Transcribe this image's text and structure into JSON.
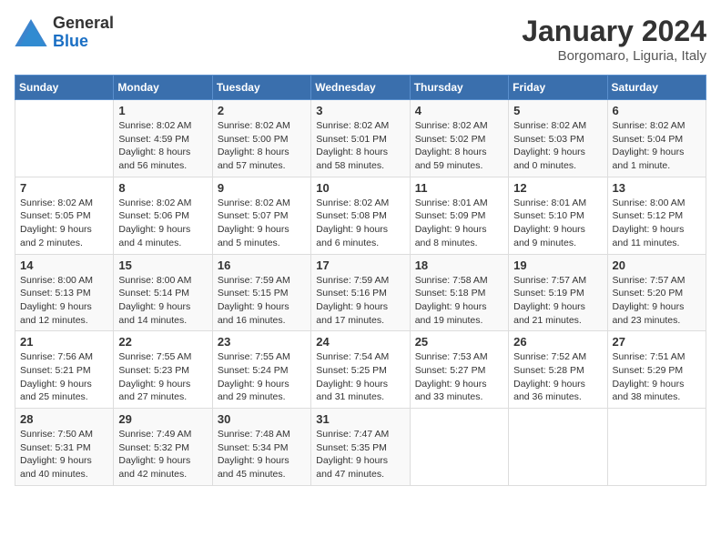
{
  "logo": {
    "general": "General",
    "blue": "Blue"
  },
  "header": {
    "title": "January 2024",
    "subtitle": "Borgomaro, Liguria, Italy"
  },
  "days_of_week": [
    "Sunday",
    "Monday",
    "Tuesday",
    "Wednesday",
    "Thursday",
    "Friday",
    "Saturday"
  ],
  "weeks": [
    [
      {
        "day": "",
        "sunrise": "",
        "sunset": "",
        "daylight": ""
      },
      {
        "day": "1",
        "sunrise": "Sunrise: 8:02 AM",
        "sunset": "Sunset: 4:59 PM",
        "daylight": "Daylight: 8 hours and 56 minutes."
      },
      {
        "day": "2",
        "sunrise": "Sunrise: 8:02 AM",
        "sunset": "Sunset: 5:00 PM",
        "daylight": "Daylight: 8 hours and 57 minutes."
      },
      {
        "day": "3",
        "sunrise": "Sunrise: 8:02 AM",
        "sunset": "Sunset: 5:01 PM",
        "daylight": "Daylight: 8 hours and 58 minutes."
      },
      {
        "day": "4",
        "sunrise": "Sunrise: 8:02 AM",
        "sunset": "Sunset: 5:02 PM",
        "daylight": "Daylight: 8 hours and 59 minutes."
      },
      {
        "day": "5",
        "sunrise": "Sunrise: 8:02 AM",
        "sunset": "Sunset: 5:03 PM",
        "daylight": "Daylight: 9 hours and 0 minutes."
      },
      {
        "day": "6",
        "sunrise": "Sunrise: 8:02 AM",
        "sunset": "Sunset: 5:04 PM",
        "daylight": "Daylight: 9 hours and 1 minute."
      }
    ],
    [
      {
        "day": "7",
        "sunrise": "Sunrise: 8:02 AM",
        "sunset": "Sunset: 5:05 PM",
        "daylight": "Daylight: 9 hours and 2 minutes."
      },
      {
        "day": "8",
        "sunrise": "Sunrise: 8:02 AM",
        "sunset": "Sunset: 5:06 PM",
        "daylight": "Daylight: 9 hours and 4 minutes."
      },
      {
        "day": "9",
        "sunrise": "Sunrise: 8:02 AM",
        "sunset": "Sunset: 5:07 PM",
        "daylight": "Daylight: 9 hours and 5 minutes."
      },
      {
        "day": "10",
        "sunrise": "Sunrise: 8:02 AM",
        "sunset": "Sunset: 5:08 PM",
        "daylight": "Daylight: 9 hours and 6 minutes."
      },
      {
        "day": "11",
        "sunrise": "Sunrise: 8:01 AM",
        "sunset": "Sunset: 5:09 PM",
        "daylight": "Daylight: 9 hours and 8 minutes."
      },
      {
        "day": "12",
        "sunrise": "Sunrise: 8:01 AM",
        "sunset": "Sunset: 5:10 PM",
        "daylight": "Daylight: 9 hours and 9 minutes."
      },
      {
        "day": "13",
        "sunrise": "Sunrise: 8:00 AM",
        "sunset": "Sunset: 5:12 PM",
        "daylight": "Daylight: 9 hours and 11 minutes."
      }
    ],
    [
      {
        "day": "14",
        "sunrise": "Sunrise: 8:00 AM",
        "sunset": "Sunset: 5:13 PM",
        "daylight": "Daylight: 9 hours and 12 minutes."
      },
      {
        "day": "15",
        "sunrise": "Sunrise: 8:00 AM",
        "sunset": "Sunset: 5:14 PM",
        "daylight": "Daylight: 9 hours and 14 minutes."
      },
      {
        "day": "16",
        "sunrise": "Sunrise: 7:59 AM",
        "sunset": "Sunset: 5:15 PM",
        "daylight": "Daylight: 9 hours and 16 minutes."
      },
      {
        "day": "17",
        "sunrise": "Sunrise: 7:59 AM",
        "sunset": "Sunset: 5:16 PM",
        "daylight": "Daylight: 9 hours and 17 minutes."
      },
      {
        "day": "18",
        "sunrise": "Sunrise: 7:58 AM",
        "sunset": "Sunset: 5:18 PM",
        "daylight": "Daylight: 9 hours and 19 minutes."
      },
      {
        "day": "19",
        "sunrise": "Sunrise: 7:57 AM",
        "sunset": "Sunset: 5:19 PM",
        "daylight": "Daylight: 9 hours and 21 minutes."
      },
      {
        "day": "20",
        "sunrise": "Sunrise: 7:57 AM",
        "sunset": "Sunset: 5:20 PM",
        "daylight": "Daylight: 9 hours and 23 minutes."
      }
    ],
    [
      {
        "day": "21",
        "sunrise": "Sunrise: 7:56 AM",
        "sunset": "Sunset: 5:21 PM",
        "daylight": "Daylight: 9 hours and 25 minutes."
      },
      {
        "day": "22",
        "sunrise": "Sunrise: 7:55 AM",
        "sunset": "Sunset: 5:23 PM",
        "daylight": "Daylight: 9 hours and 27 minutes."
      },
      {
        "day": "23",
        "sunrise": "Sunrise: 7:55 AM",
        "sunset": "Sunset: 5:24 PM",
        "daylight": "Daylight: 9 hours and 29 minutes."
      },
      {
        "day": "24",
        "sunrise": "Sunrise: 7:54 AM",
        "sunset": "Sunset: 5:25 PM",
        "daylight": "Daylight: 9 hours and 31 minutes."
      },
      {
        "day": "25",
        "sunrise": "Sunrise: 7:53 AM",
        "sunset": "Sunset: 5:27 PM",
        "daylight": "Daylight: 9 hours and 33 minutes."
      },
      {
        "day": "26",
        "sunrise": "Sunrise: 7:52 AM",
        "sunset": "Sunset: 5:28 PM",
        "daylight": "Daylight: 9 hours and 36 minutes."
      },
      {
        "day": "27",
        "sunrise": "Sunrise: 7:51 AM",
        "sunset": "Sunset: 5:29 PM",
        "daylight": "Daylight: 9 hours and 38 minutes."
      }
    ],
    [
      {
        "day": "28",
        "sunrise": "Sunrise: 7:50 AM",
        "sunset": "Sunset: 5:31 PM",
        "daylight": "Daylight: 9 hours and 40 minutes."
      },
      {
        "day": "29",
        "sunrise": "Sunrise: 7:49 AM",
        "sunset": "Sunset: 5:32 PM",
        "daylight": "Daylight: 9 hours and 42 minutes."
      },
      {
        "day": "30",
        "sunrise": "Sunrise: 7:48 AM",
        "sunset": "Sunset: 5:34 PM",
        "daylight": "Daylight: 9 hours and 45 minutes."
      },
      {
        "day": "31",
        "sunrise": "Sunrise: 7:47 AM",
        "sunset": "Sunset: 5:35 PM",
        "daylight": "Daylight: 9 hours and 47 minutes."
      },
      {
        "day": "",
        "sunrise": "",
        "sunset": "",
        "daylight": ""
      },
      {
        "day": "",
        "sunrise": "",
        "sunset": "",
        "daylight": ""
      },
      {
        "day": "",
        "sunrise": "",
        "sunset": "",
        "daylight": ""
      }
    ]
  ]
}
